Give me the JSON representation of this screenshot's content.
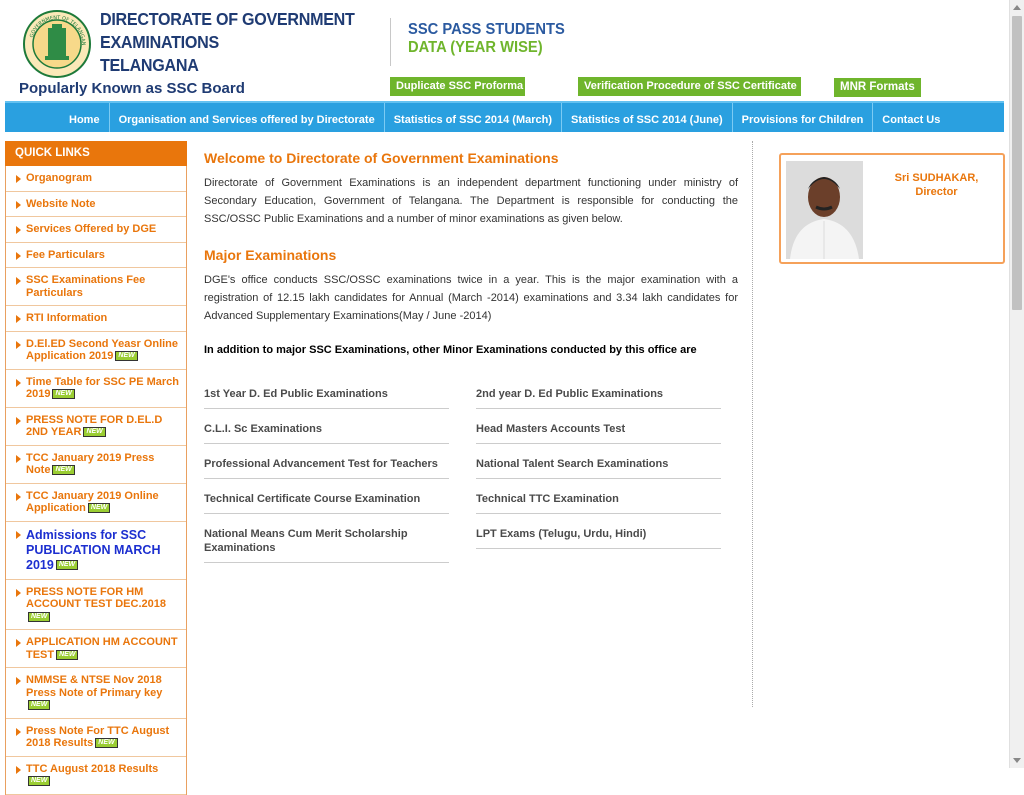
{
  "header": {
    "title_lines": [
      "DIRECTORATE OF GOVERNMENT",
      "EXAMINATIONS",
      "TELANGANA"
    ],
    "tagline": "Popularly Known as SSC Board",
    "ssc_pass_line1": "SSC PASS STUDENTS",
    "ssc_pass_line2": "DATA (YEAR WISE)",
    "buttons": [
      {
        "label": "Duplicate SSC Proforma"
      },
      {
        "label": "Verification Procedure of SSC Certificate"
      },
      {
        "label": "MNR Formats"
      }
    ],
    "colors": {
      "brand": "#1f3b73",
      "accent": "#e9760c",
      "green": "#6fb52c",
      "nav": "#2aa0e0"
    }
  },
  "nav": [
    {
      "label": "Home"
    },
    {
      "label": "Organisation and Services offered by Directorate"
    },
    {
      "label": "Statistics of SSC 2014 (March)"
    },
    {
      "label": "Statistics of SSC 2014 (June)"
    },
    {
      "label": "Provisions for Children"
    },
    {
      "label": "Contact Us"
    }
  ],
  "sidebar": {
    "header": "QUICK LINKS",
    "items": [
      {
        "label": "Organogram",
        "new": ""
      },
      {
        "label": "Website Note",
        "new": ""
      },
      {
        "label": "Services Offered by DGE",
        "new": ""
      },
      {
        "label": "Fee Particulars",
        "new": ""
      },
      {
        "label": "SSC Examinations Fee Particulars",
        "new": ""
      },
      {
        "label": "RTI Information",
        "new": ""
      },
      {
        "label": "D.El.ED Second Yeasr Online Application 2019",
        "new": "NEW"
      },
      {
        "label": "Time Table for SSC PE March 2019",
        "new": "NEW"
      },
      {
        "label": "PRESS NOTE FOR D.EL.D 2ND YEAR",
        "new": "NEW"
      },
      {
        "label": "TCC January 2019 Press Note",
        "new": "NEW"
      },
      {
        "label": "TCC January 2019 Online Application",
        "new": "NEW"
      },
      {
        "label": "Admissions for SSC PUBLICATION MARCH 2019",
        "new": "NEW",
        "big": true
      },
      {
        "label": "PRESS NOTE FOR HM ACCOUNT TEST DEC.2018",
        "new": "NEW"
      },
      {
        "label": "APPLICATION HM ACCOUNT TEST",
        "new": "NEW"
      },
      {
        "label": "NMMSE & NTSE Nov 2018 Press Note of Primary key",
        "new": "NEW"
      },
      {
        "label": "Press Note For TTC August 2018 Results",
        "new": "NEW"
      },
      {
        "label": "TTC August 2018 Results",
        "new": "NEW"
      }
    ]
  },
  "main": {
    "welcome_title": "Welcome to Directorate of Government Examinations",
    "welcome_text": "Directorate of Government Examinations is an independent department functioning under ministry of Secondary Education, Government of Telangana. The Department is responsible for conducting the SSC/OSSC Public Examinations and a number of minor examinations as given below.",
    "major_title": "Major Examinations",
    "major_text": "DGE's office conducts SSC/OSSC examinations twice in a year. This is the major examination with a registration of 12.15 lakh candidates for Annual (March -2014) examinations and 3.34 lakh candidates for Advanced Supplementary Examinations(May / June -2014)",
    "minor_heading": "In addition to major SSC Examinations, other Minor Examinations conducted by this office are",
    "exams_left": [
      "1st Year D. Ed Public Examinations",
      "C.L.I. Sc Examinations",
      "Professional Advancement Test for Teachers",
      "Technical Certificate Course Examination",
      "National Means Cum Merit Scholarship Examinations"
    ],
    "exams_right": [
      "2nd year D. Ed Public Examinations",
      "Head Masters Accounts Test",
      "National Talent Search Examinations",
      "Technical TTC Examination",
      "LPT Exams (Telugu, Urdu, Hindi)"
    ]
  },
  "director": {
    "name": "Sri SUDHAKAR,",
    "title": "Director"
  },
  "logo_text": "GOVERNMENT OF TELANGANA"
}
